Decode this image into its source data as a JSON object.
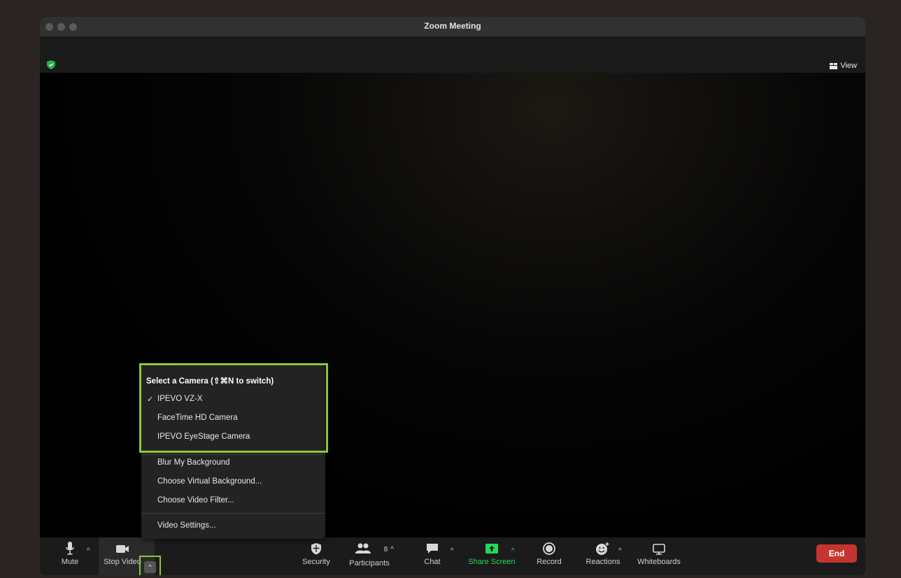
{
  "window": {
    "title": "Zoom Meeting"
  },
  "topbar": {
    "view_label": "View"
  },
  "menu": {
    "header": "Select a Camera (⇧⌘N to switch)",
    "cameras": [
      {
        "label": "IPEVO VZ-X",
        "checked": true
      },
      {
        "label": "FaceTime HD Camera",
        "checked": false
      },
      {
        "label": "IPEVO EyeStage Camera",
        "checked": false
      }
    ],
    "options": [
      "Blur My Background",
      "Choose Virtual Background...",
      "Choose Video Filter..."
    ],
    "settings": "Video Settings..."
  },
  "toolbar": {
    "mute": "Mute",
    "stop_video": "Stop Video",
    "security": "Security",
    "participants": "Participants",
    "participants_count": "8",
    "chat": "Chat",
    "share_screen": "Share Screen",
    "record": "Record",
    "reactions": "Reactions",
    "whiteboards": "Whiteboards",
    "end": "End"
  },
  "colors": {
    "highlight": "#8cc63f",
    "share_green": "#23d959",
    "end_red": "#c5352f",
    "security_shield": "#23b24a"
  }
}
